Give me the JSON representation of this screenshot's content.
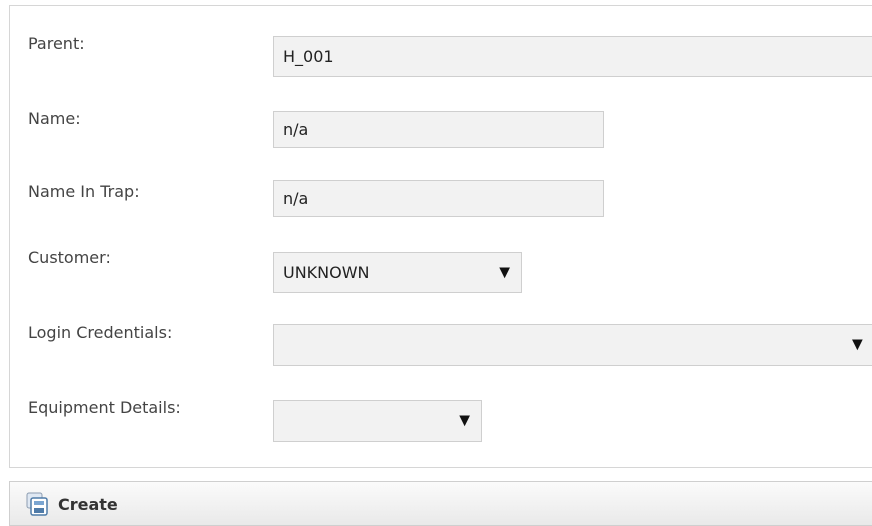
{
  "form": {
    "parent": {
      "label": "Parent:",
      "value": "H_001"
    },
    "name": {
      "label": "Name:",
      "value": "n/a"
    },
    "name_in_trap": {
      "label": "Name In Trap:",
      "value": "n/a"
    },
    "customer": {
      "label": "Customer:",
      "selected": "UNKNOWN"
    },
    "login_credentials": {
      "label": "Login Credentials:",
      "selected": ""
    },
    "equipment_details": {
      "label": "Equipment Details:",
      "selected": ""
    }
  },
  "toolbar": {
    "create_label": "Create",
    "create_icon": "save-disk-icon"
  }
}
